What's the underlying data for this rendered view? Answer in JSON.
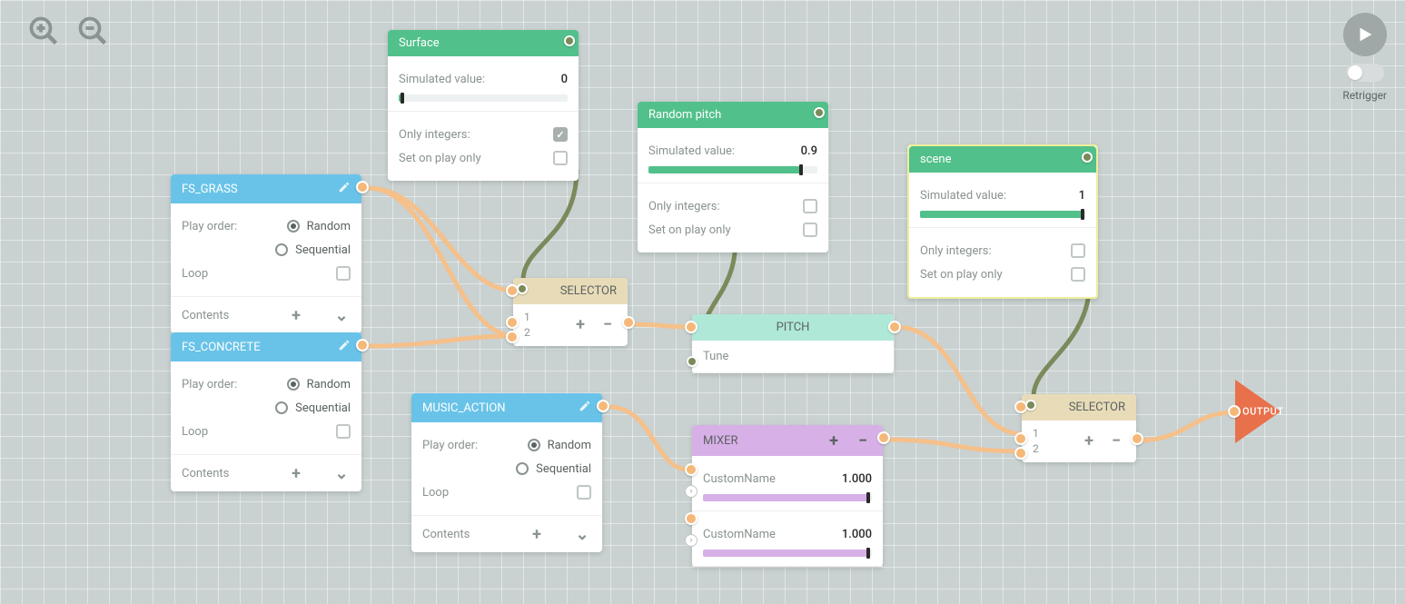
{
  "toolbar": {
    "retrigger": "Retrigger"
  },
  "labels": {
    "play_order": "Play order:",
    "random": "Random",
    "sequential": "Sequential",
    "loop": "Loop",
    "contents": "Contents",
    "simulated_value": "Simulated value:",
    "only_integers": "Only integers:",
    "set_on_play_only": "Set on play only"
  },
  "nodes": {
    "fs_grass": {
      "title": "FS_GRASS"
    },
    "fs_concrete": {
      "title": "FS_CONCRETE"
    },
    "music_action": {
      "title": "MUSIC_ACTION"
    },
    "surface": {
      "title": "Surface",
      "value": "0",
      "fill": 2,
      "only_int": true,
      "set_on_play": false
    },
    "random_pitch": {
      "title": "Random pitch",
      "value": "0.9",
      "fill": 90,
      "only_int": false,
      "set_on_play": false
    },
    "scene": {
      "title": "scene",
      "value": "1",
      "fill": 98,
      "only_int": false,
      "set_on_play": false
    },
    "selector1": {
      "title": "SELECTOR",
      "opt1": "1",
      "opt2": "2"
    },
    "selector2": {
      "title": "SELECTOR",
      "opt1": "1",
      "opt2": "2"
    },
    "pitch": {
      "title": "PITCH",
      "tune": "Tune"
    },
    "mixer": {
      "title": "MIXER",
      "ch1_name": "CustomName",
      "ch1_val": "1.000",
      "ch2_name": "CustomName",
      "ch2_val": "1.000"
    }
  },
  "output": {
    "label": "OUTPUT"
  }
}
